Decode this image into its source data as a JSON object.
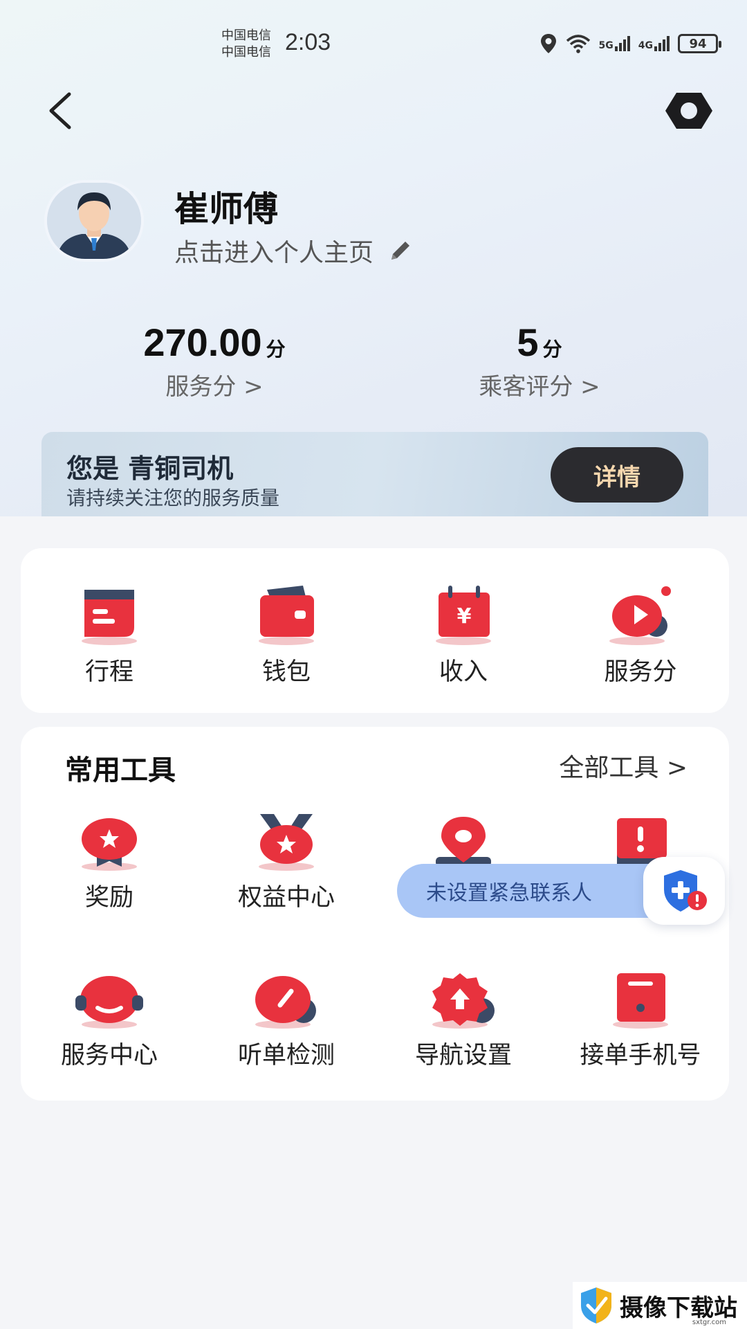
{
  "status_bar": {
    "carrier_1": "中国电信",
    "carrier_2": "中国电信",
    "time": "2:03",
    "network_1": "5G",
    "network_2": "4G",
    "battery": "94"
  },
  "profile": {
    "name": "崔师傅",
    "link_text": "点击进入个人主页"
  },
  "stats": [
    {
      "value": "270.00",
      "unit": "分",
      "label": "服务分 >"
    },
    {
      "value": "5",
      "unit": "分",
      "label": "乘客评分 >"
    }
  ],
  "level_banner": {
    "title": "您是 青铜司机",
    "subtitle": "请持续关注您的服务质量",
    "button": "详情"
  },
  "quick_actions": [
    {
      "label": "行程",
      "icon": "trip-icon"
    },
    {
      "label": "钱包",
      "icon": "wallet-icon"
    },
    {
      "label": "收入",
      "icon": "income-icon"
    },
    {
      "label": "服务分",
      "icon": "service-score-icon"
    }
  ],
  "tools": {
    "title": "常用工具",
    "all_label": "全部工具 >",
    "items": [
      {
        "label": "奖励",
        "icon": "reward-icon"
      },
      {
        "label": "权益中心",
        "icon": "benefits-medal-icon"
      },
      {
        "label": "",
        "icon": "location-pin-icon"
      },
      {
        "label": "",
        "icon": "alert-icon"
      },
      {
        "label": "服务中心",
        "icon": "headset-icon"
      },
      {
        "label": "听单检测",
        "icon": "gauge-icon"
      },
      {
        "label": "导航设置",
        "icon": "navigation-gear-icon"
      },
      {
        "label": "接单手机号",
        "icon": "phone-icon"
      }
    ]
  },
  "toast": {
    "text": "未设置紧急联系人"
  },
  "watermark": {
    "text": "摄像下载站",
    "sub": "sxtgr.com"
  },
  "colors": {
    "brand_red": "#e8323e",
    "dark_button": "#2b2b2f",
    "button_text_gold": "#f6d7ae",
    "toast_bg": "#a9c6f6",
    "page_bg": "#f4f5f8"
  }
}
